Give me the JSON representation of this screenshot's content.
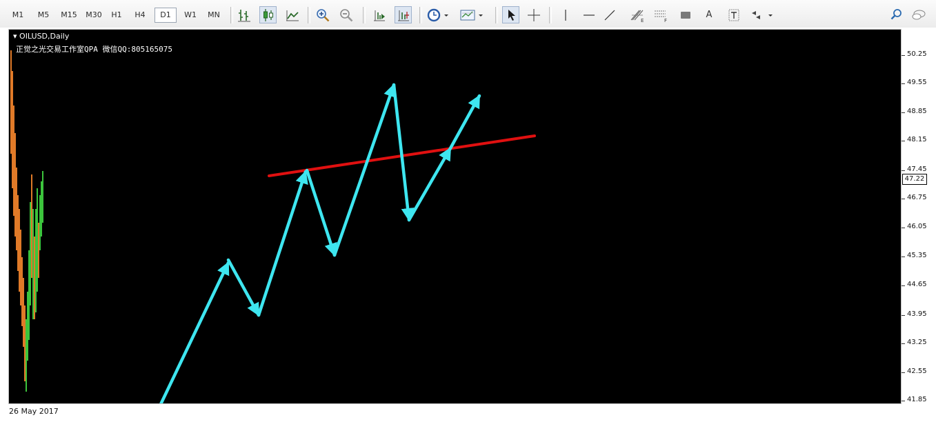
{
  "toolbar": {
    "timeframes": [
      {
        "label": "M1",
        "active": false
      },
      {
        "label": "M5",
        "active": false
      },
      {
        "label": "M15",
        "active": false
      },
      {
        "label": "M30",
        "active": false
      },
      {
        "label": "H1",
        "active": false
      },
      {
        "label": "H4",
        "active": false
      },
      {
        "label": "D1",
        "active": true
      },
      {
        "label": "W1",
        "active": false
      },
      {
        "label": "MN",
        "active": false
      }
    ],
    "tools": [
      "bar-chart-icon",
      "candlestick-icon",
      "line-chart-icon",
      "zoom-in-icon",
      "zoom-out-icon",
      "chart-shift-icon",
      "auto-scroll-icon",
      "periods-icon",
      "templates-icon",
      "cursor-icon",
      "crosshair-icon",
      "vertical-line-icon",
      "horizontal-line-icon",
      "trendline-icon",
      "fibonacci-icon",
      "fibo-expansion-icon",
      "rectangle-icon",
      "text-icon",
      "text-label-icon",
      "arrows-icon",
      "search-icon",
      "chat-icon"
    ],
    "text_tool_label": "A"
  },
  "chart": {
    "symbol": "OILUSD,Daily",
    "caption": "正觉之光交易工作室QPA 微信QQ:805165075",
    "current_price": "47.22",
    "date_label": "26 May 2017",
    "price_labels": [
      "50.25",
      "49.55",
      "48.85",
      "48.15",
      "47.45",
      "46.75",
      "46.05",
      "45.35",
      "44.65",
      "43.95",
      "43.25",
      "42.55",
      "41.85"
    ],
    "colors": {
      "background": "#000000",
      "arrow": "#3ee6f0",
      "trendline": "#e01010",
      "bull_candle": "#3cc43c",
      "bear_candle": "#e07a28"
    }
  }
}
